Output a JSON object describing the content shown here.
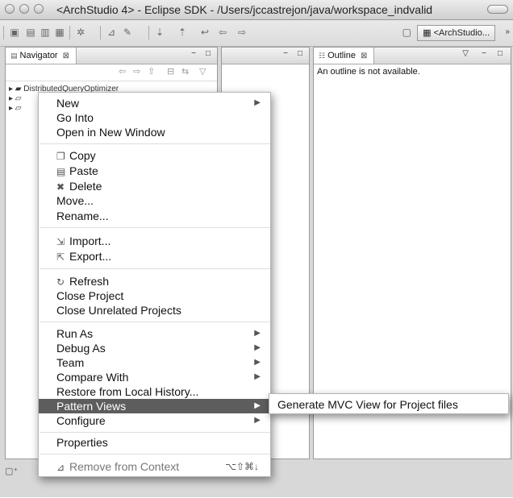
{
  "window": {
    "title": "<ArchStudio 4> - Eclipse SDK - /Users/jccastrejon/java/workspace_indvalid"
  },
  "toolbar": {
    "perspective_label": "<ArchStudio...",
    "overflow": "»"
  },
  "navigator": {
    "tab_label": "Navigator",
    "close": "⊠",
    "minimize": "−",
    "maximize": "□",
    "tree": [
      {
        "label": "DistributedQueryOptimizer"
      },
      {
        "label": ""
      },
      {
        "label": ""
      }
    ]
  },
  "editor": {
    "minimize": "−",
    "maximize": "□"
  },
  "outline": {
    "tab_label": "Outline",
    "close": "⊠",
    "message": "An outline is not available."
  },
  "context_menu": {
    "items": [
      {
        "label": "New",
        "submenu": true
      },
      {
        "label": "Go Into"
      },
      {
        "label": "Open in New Window"
      },
      {
        "label": "Copy",
        "icon": "copy-icon"
      },
      {
        "label": "Paste",
        "icon": "paste-icon"
      },
      {
        "label": "Delete",
        "icon": "delete-icon"
      },
      {
        "label": "Move..."
      },
      {
        "label": "Rename..."
      },
      {
        "label": "Import...",
        "icon": "import-icon"
      },
      {
        "label": "Export...",
        "icon": "export-icon"
      },
      {
        "label": "Refresh",
        "icon": "refresh-icon"
      },
      {
        "label": "Close Project"
      },
      {
        "label": "Close Unrelated Projects"
      },
      {
        "label": "Run As",
        "submenu": true
      },
      {
        "label": "Debug As",
        "submenu": true
      },
      {
        "label": "Team",
        "submenu": true
      },
      {
        "label": "Compare With",
        "submenu": true
      },
      {
        "label": "Restore from Local History..."
      },
      {
        "label": "Pattern Views",
        "submenu": true,
        "highlighted": true
      },
      {
        "label": "Configure",
        "submenu": true
      },
      {
        "label": "Properties"
      },
      {
        "label": "Remove from Context",
        "shortcut": "⌥⇧⌘↓",
        "disabled": true
      }
    ]
  },
  "submenu": {
    "items": [
      {
        "label": "Generate MVC View for Project files"
      }
    ]
  }
}
